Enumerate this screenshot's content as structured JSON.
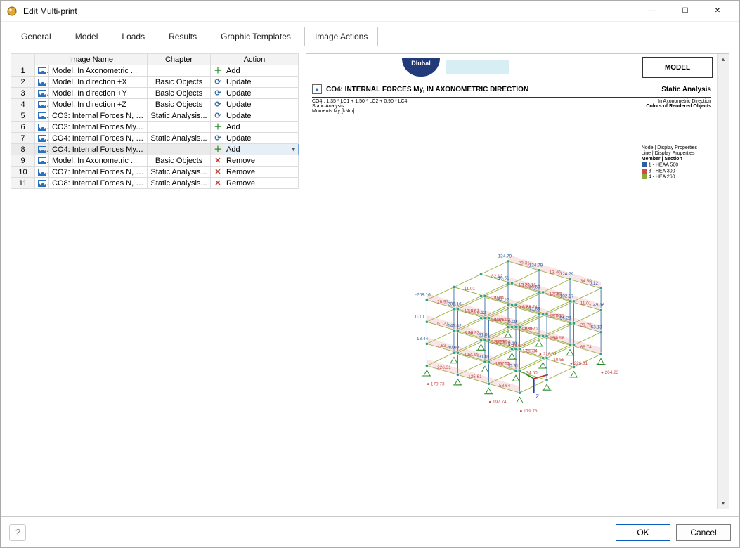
{
  "window": {
    "title": "Edit Multi-print",
    "min": "—",
    "max": "☐",
    "close": "✕"
  },
  "tabs": [
    {
      "label": "General",
      "active": false
    },
    {
      "label": "Model",
      "active": false
    },
    {
      "label": "Loads",
      "active": false
    },
    {
      "label": "Results",
      "active": false
    },
    {
      "label": "Graphic Templates",
      "active": false
    },
    {
      "label": "Image Actions",
      "active": true
    }
  ],
  "table_headers": {
    "image_name": "Image Name",
    "chapter": "Chapter",
    "action": "Action"
  },
  "actions": {
    "add": "Add",
    "update": "Update",
    "remove": "Remove"
  },
  "rows": [
    {
      "n": "1",
      "name": "Model, In Axonometric ...",
      "chapter": "",
      "action": "add"
    },
    {
      "n": "2",
      "name": "Model, In direction +X",
      "chapter": "Basic Objects",
      "action": "update"
    },
    {
      "n": "3",
      "name": "Model, In direction +Y",
      "chapter": "Basic Objects",
      "action": "update"
    },
    {
      "n": "4",
      "name": "Model, In direction +Z",
      "chapter": "Basic Objects",
      "action": "update"
    },
    {
      "n": "5",
      "name": "CO3: Internal Forces N, I...",
      "chapter": "Static Analysis...",
      "action": "update"
    },
    {
      "n": "6",
      "name": "CO3: Internal Forces My, ...",
      "chapter": "",
      "action": "add"
    },
    {
      "n": "7",
      "name": "CO4: Internal Forces N, I...",
      "chapter": "Static Analysis...",
      "action": "update"
    },
    {
      "n": "8",
      "name": "CO4: Internal Forces My, ...",
      "chapter": "",
      "action": "add",
      "selected": true
    },
    {
      "n": "9",
      "name": "Model, In Axonometric ...",
      "chapter": "Basic Objects",
      "action": "remove"
    },
    {
      "n": "10",
      "name": "CO7: Internal Forces N, I...",
      "chapter": "Static Analysis...",
      "action": "remove"
    },
    {
      "n": "11",
      "name": "CO8: Internal Forces N, I...",
      "chapter": "Static Analysis...",
      "action": "remove"
    }
  ],
  "preview": {
    "brand": "Dlubal",
    "tab_label": "MODEL",
    "title": "CO4: INTERNAL FORCES My, IN AXONOMETRIC DIRECTION",
    "right_title": "Static Analysis",
    "meta_left1": "CO4 : 1.35 * LC1 + 1.50 * LC2 + 0.90 * LC4",
    "meta_left2": "Static Analysis",
    "meta_left3": "Moments My [kNm]",
    "meta_right1": "In Axonometric Direction",
    "meta_right2": "Colors of Rendered Objects",
    "legend_h1": "Node | Display Properties",
    "legend_h2": "Line | Display Properties",
    "legend_h3": "Member | Section",
    "legend_i1": "1 - HEAA 500",
    "legend_i2": "3 - HEA 300",
    "legend_i3": "4 - HEA 260",
    "labels_red": [
      "179.73",
      "226.31",
      "197.74",
      "226.31",
      "264.23",
      "179.73",
      "197.74",
      "125.61",
      "68.74",
      "10.55",
      "34.50",
      "58.64",
      "9.83",
      "58.64",
      "3.30",
      "7.63",
      "28.80",
      "29.15",
      "18.06",
      "61.37",
      "21.75",
      "63.13",
      "29.04",
      "67.25",
      "10.21",
      "28.81",
      "13.61",
      "61.27",
      "17.30",
      "9.31",
      "82.12",
      "64.93",
      "11.01",
      "77.11",
      "29.20",
      "22.54",
      "29.31",
      "82.12",
      "11.01",
      "26.97",
      "13.40",
      "120.16",
      "9.84",
      "13.61",
      "34.50",
      "7.63",
      "68.74",
      "96.23",
      "244.00",
      "239.75",
      "162.56",
      "121.08",
      "145.36",
      "172.11",
      "120.16",
      "102.20",
      "14.16"
    ],
    "labels_blue": [
      "-124.79",
      "-208.16",
      "-124.79",
      "-208.16",
      "-124.79",
      "0.12",
      "0.12",
      "0.09",
      "-13.61",
      "0.10",
      "-40.60",
      "-145.42",
      "-102.17",
      "-31.01",
      "-145.36",
      "0.10",
      "-54.27",
      "-13.44",
      "-71.89",
      "-40.60",
      "-96.23",
      "-31.01",
      "-63.13",
      "-0.91",
      "-13.44",
      "-43.25",
      "-14.35",
      "-114.35",
      "-10.20"
    ]
  },
  "footer": {
    "ok": "OK",
    "cancel": "Cancel"
  }
}
